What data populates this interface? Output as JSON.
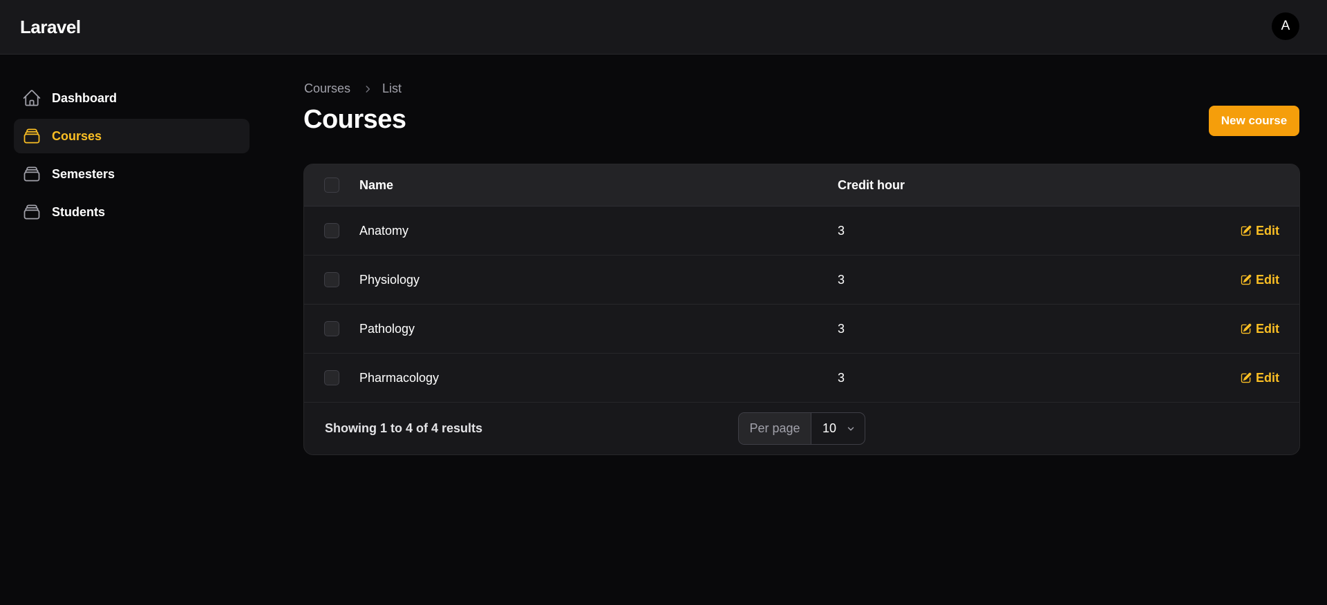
{
  "header": {
    "brand": "Laravel",
    "avatar_initial": "A"
  },
  "sidebar": {
    "items": [
      {
        "label": "Dashboard",
        "icon": "home-icon",
        "active": false
      },
      {
        "label": "Courses",
        "icon": "stack-icon",
        "active": true
      },
      {
        "label": "Semesters",
        "icon": "stack-icon",
        "active": false
      },
      {
        "label": "Students",
        "icon": "stack-icon",
        "active": false
      }
    ]
  },
  "breadcrumb": {
    "root": "Courses",
    "current": "List",
    "separator_icon": "chevron-right-icon"
  },
  "page": {
    "title": "Courses",
    "new_button": "New course"
  },
  "table": {
    "columns": {
      "name": "Name",
      "credit": "Credit hour"
    },
    "rows": [
      {
        "name": "Anatomy",
        "credit": "3",
        "action": "Edit"
      },
      {
        "name": "Physiology",
        "credit": "3",
        "action": "Edit"
      },
      {
        "name": "Pathology",
        "credit": "3",
        "action": "Edit"
      },
      {
        "name": "Pharmacology",
        "credit": "3",
        "action": "Edit"
      }
    ],
    "footer": {
      "results": "Showing 1 to 4 of 4 results",
      "per_page_label": "Per page",
      "per_page_value": "10"
    }
  },
  "colors": {
    "accent": "#f59e0b",
    "accent_text": "#fbbf24",
    "background": "#09090b",
    "surface": "#18181b"
  }
}
